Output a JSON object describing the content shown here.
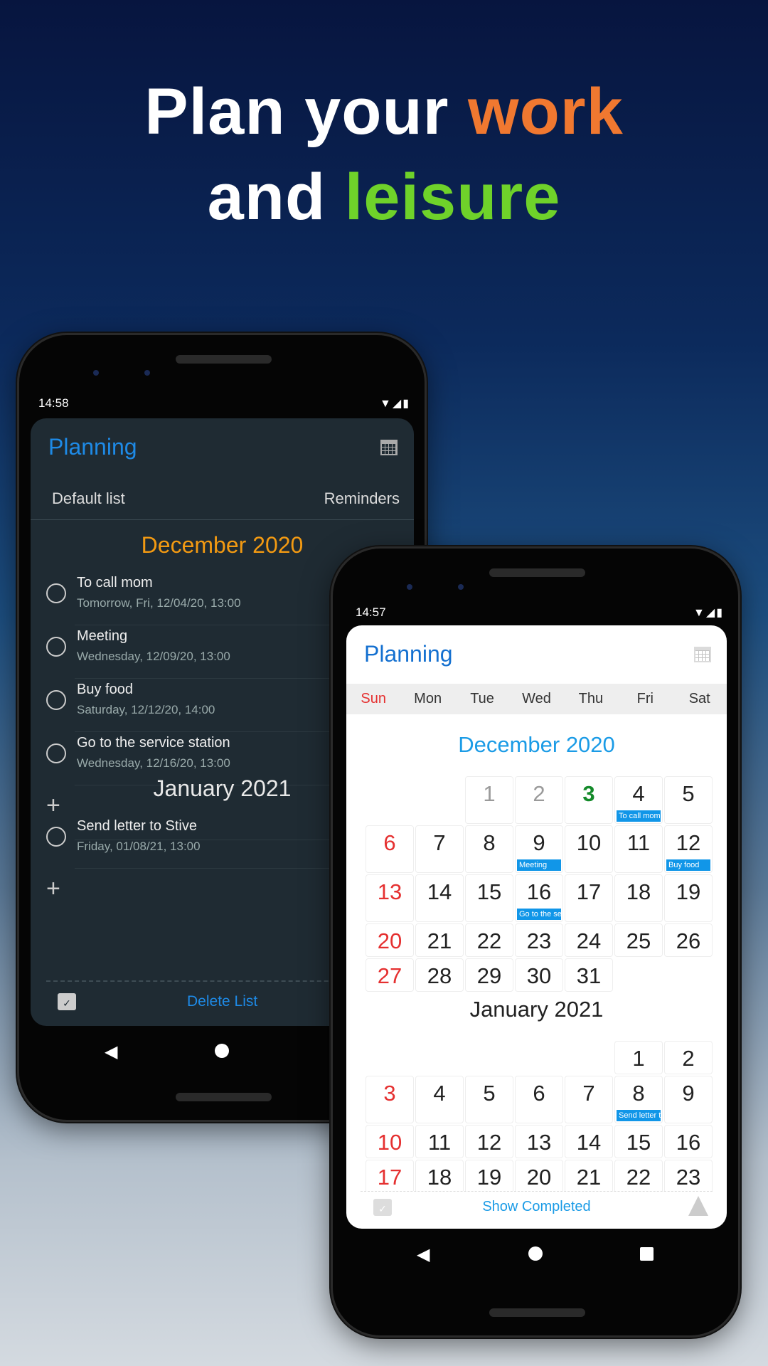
{
  "headline": {
    "line1_a": "Plan your ",
    "line1_b": "work",
    "line2_a": "and ",
    "line2_b": "leisure",
    "color_work": "#f07830",
    "color_leisure": "#6fd22a"
  },
  "phone_left": {
    "time": "14:58",
    "status_icons": "▼◢▮",
    "app_title": "Planning",
    "tabs": [
      "Default list",
      "Reminders"
    ],
    "sections": [
      {
        "month": "December 2020",
        "color": "#f39a12",
        "items": [
          {
            "title": "To call mom",
            "subtitle": "Tomorrow, Fri, 12/04/20, 13:00"
          },
          {
            "title": "Meeting",
            "subtitle": "Wednesday, 12/09/20, 13:00"
          },
          {
            "title": "Buy food",
            "subtitle": "Saturday, 12/12/20, 14:00"
          },
          {
            "title": "Go to the service station",
            "subtitle": "Wednesday, 12/16/20, 13:00"
          }
        ]
      },
      {
        "month": "January 2021",
        "color": "#e8e8e8",
        "items": [
          {
            "title": "Send letter to Stive",
            "subtitle": "Friday, 01/08/21, 13:00"
          }
        ]
      }
    ],
    "add_symbol": "+",
    "delete_label": "Delete List"
  },
  "phone_right": {
    "time": "14:57",
    "status_icons": "▼◢▮",
    "app_title": "Planning",
    "weekdays": [
      "Sun",
      "Mon",
      "Tue",
      "Wed",
      "Thu",
      "Fri",
      "Sat"
    ],
    "months": [
      {
        "title": "December 2020",
        "color": "#1a9be6",
        "weeks": [
          [
            null,
            null,
            {
              "d": "1",
              "style": "past"
            },
            {
              "d": "2",
              "style": "past"
            },
            {
              "d": "3",
              "style": "today"
            },
            {
              "d": "4",
              "ev": "To call mom"
            },
            {
              "d": "5"
            }
          ],
          [
            {
              "d": "6"
            },
            {
              "d": "7"
            },
            {
              "d": "8"
            },
            {
              "d": "9",
              "ev": "Meeting"
            },
            {
              "d": "10"
            },
            {
              "d": "11"
            },
            {
              "d": "12",
              "ev": "Buy food"
            }
          ],
          [
            {
              "d": "13"
            },
            {
              "d": "14"
            },
            {
              "d": "15"
            },
            {
              "d": "16",
              "ev": "Go to the service station"
            },
            {
              "d": "17"
            },
            {
              "d": "18"
            },
            {
              "d": "19"
            }
          ],
          [
            {
              "d": "20"
            },
            {
              "d": "21"
            },
            {
              "d": "22"
            },
            {
              "d": "23"
            },
            {
              "d": "24"
            },
            {
              "d": "25"
            },
            {
              "d": "26"
            }
          ],
          [
            {
              "d": "27"
            },
            {
              "d": "28"
            },
            {
              "d": "29"
            },
            {
              "d": "30"
            },
            {
              "d": "31"
            },
            null,
            null
          ]
        ]
      },
      {
        "title": "January 2021",
        "color": "#222222",
        "weeks": [
          [
            null,
            null,
            null,
            null,
            null,
            {
              "d": "1"
            },
            {
              "d": "2"
            }
          ],
          [
            {
              "d": "3"
            },
            {
              "d": "4"
            },
            {
              "d": "5"
            },
            {
              "d": "6"
            },
            {
              "d": "7"
            },
            {
              "d": "8",
              "ev": "Send letter to Stive"
            },
            {
              "d": "9"
            }
          ],
          [
            {
              "d": "10"
            },
            {
              "d": "11"
            },
            {
              "d": "12"
            },
            {
              "d": "13"
            },
            {
              "d": "14"
            },
            {
              "d": "15"
            },
            {
              "d": "16"
            }
          ],
          [
            {
              "d": "17"
            },
            {
              "d": "18"
            },
            {
              "d": "19"
            },
            {
              "d": "20"
            },
            {
              "d": "21"
            },
            {
              "d": "22"
            },
            {
              "d": "23"
            }
          ]
        ]
      }
    ],
    "show_completed_label": "Show Completed",
    "colors": {
      "sunday": "#e53030",
      "today": "#148a2a",
      "past": "#9a9a9a",
      "event": "#1196e8"
    }
  }
}
